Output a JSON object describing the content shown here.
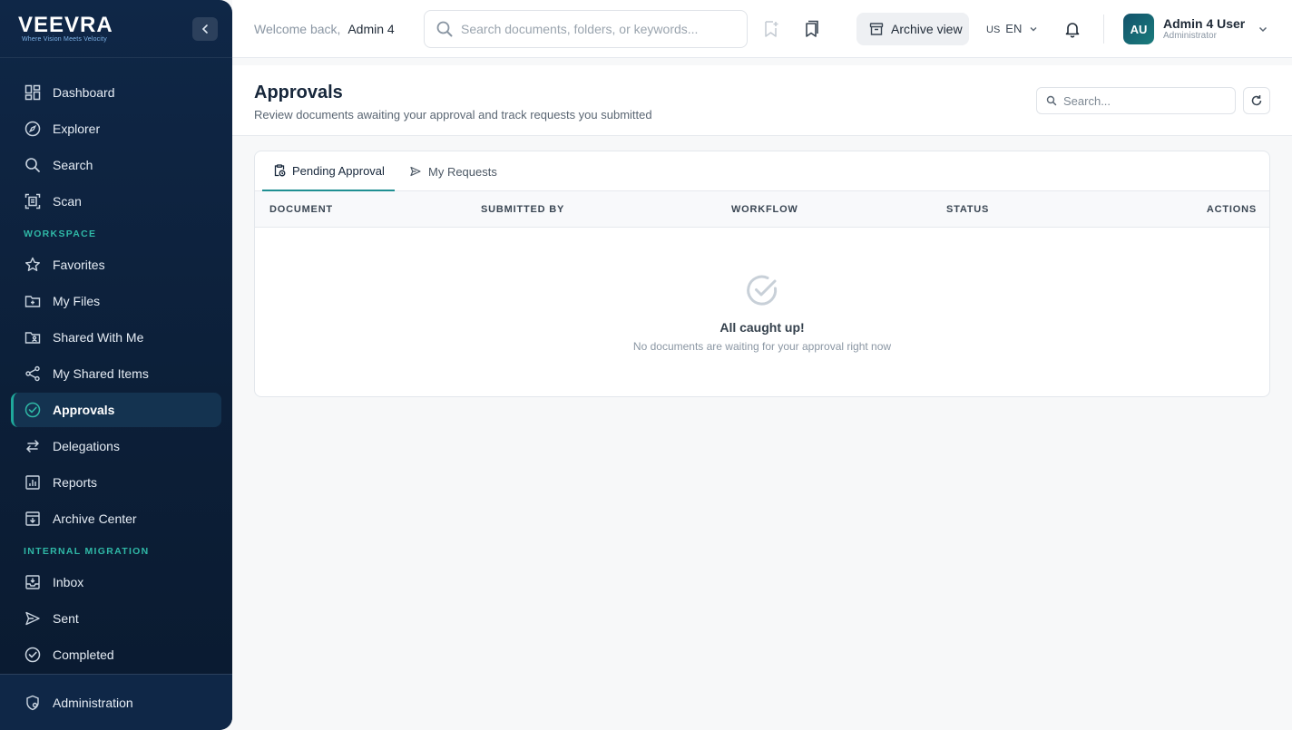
{
  "brand": {
    "name": "VEEVRA",
    "tagline": "Where Vision Meets Velocity"
  },
  "sidebar": {
    "main_items": [
      {
        "label": "Dashboard",
        "icon": "dashboard-icon"
      },
      {
        "label": "Explorer",
        "icon": "compass-icon"
      },
      {
        "label": "Search",
        "icon": "search-icon"
      },
      {
        "label": "Scan",
        "icon": "scan-icon"
      }
    ],
    "workspace_label": "WORKSPACE",
    "workspace_items": [
      {
        "label": "Favorites",
        "icon": "star-icon"
      },
      {
        "label": "My Files",
        "icon": "folder-plus-icon"
      },
      {
        "label": "Shared With Me",
        "icon": "folder-user-icon"
      },
      {
        "label": "My Shared Items",
        "icon": "share-icon"
      },
      {
        "label": "Approvals",
        "icon": "check-circle-icon",
        "active": true
      },
      {
        "label": "Delegations",
        "icon": "swap-arrows-icon"
      },
      {
        "label": "Reports",
        "icon": "report-chart-icon"
      },
      {
        "label": "Archive Center",
        "icon": "archive-icon"
      }
    ],
    "migration_label": "INTERNAL MIGRATION",
    "migration_items": [
      {
        "label": "Inbox",
        "icon": "inbox-icon"
      },
      {
        "label": "Sent",
        "icon": "send-icon"
      },
      {
        "label": "Completed",
        "icon": "check-circle-icon"
      }
    ],
    "footer_item": {
      "label": "Administration",
      "icon": "shield-gear-icon"
    }
  },
  "topbar": {
    "welcome_prefix": "Welcome back,",
    "welcome_name": "Admin 4",
    "search_placeholder": "Search documents, folders, or keywords...",
    "archive_label": "Archive view",
    "lang_flag": "US",
    "lang_code": "EN",
    "user_initials": "AU",
    "user_name": "Admin 4 User",
    "user_role": "Administrator"
  },
  "page": {
    "title": "Approvals",
    "subtitle": "Review documents awaiting your approval and track requests you submitted",
    "search_placeholder": "Search..."
  },
  "tabs": [
    {
      "label": "Pending Approval",
      "active": true
    },
    {
      "label": "My Requests",
      "active": false
    }
  ],
  "table": {
    "columns": [
      "DOCUMENT",
      "SUBMITTED BY",
      "WORKFLOW",
      "STATUS",
      "ACTIONS"
    ],
    "rows": []
  },
  "empty_state": {
    "title": "All caught up!",
    "subtitle": "No documents are waiting for your approval right now"
  },
  "colors": {
    "sidebar_bg": "#0f2747",
    "accent": "#1fa89b",
    "section_label": "#2fb8a6"
  }
}
